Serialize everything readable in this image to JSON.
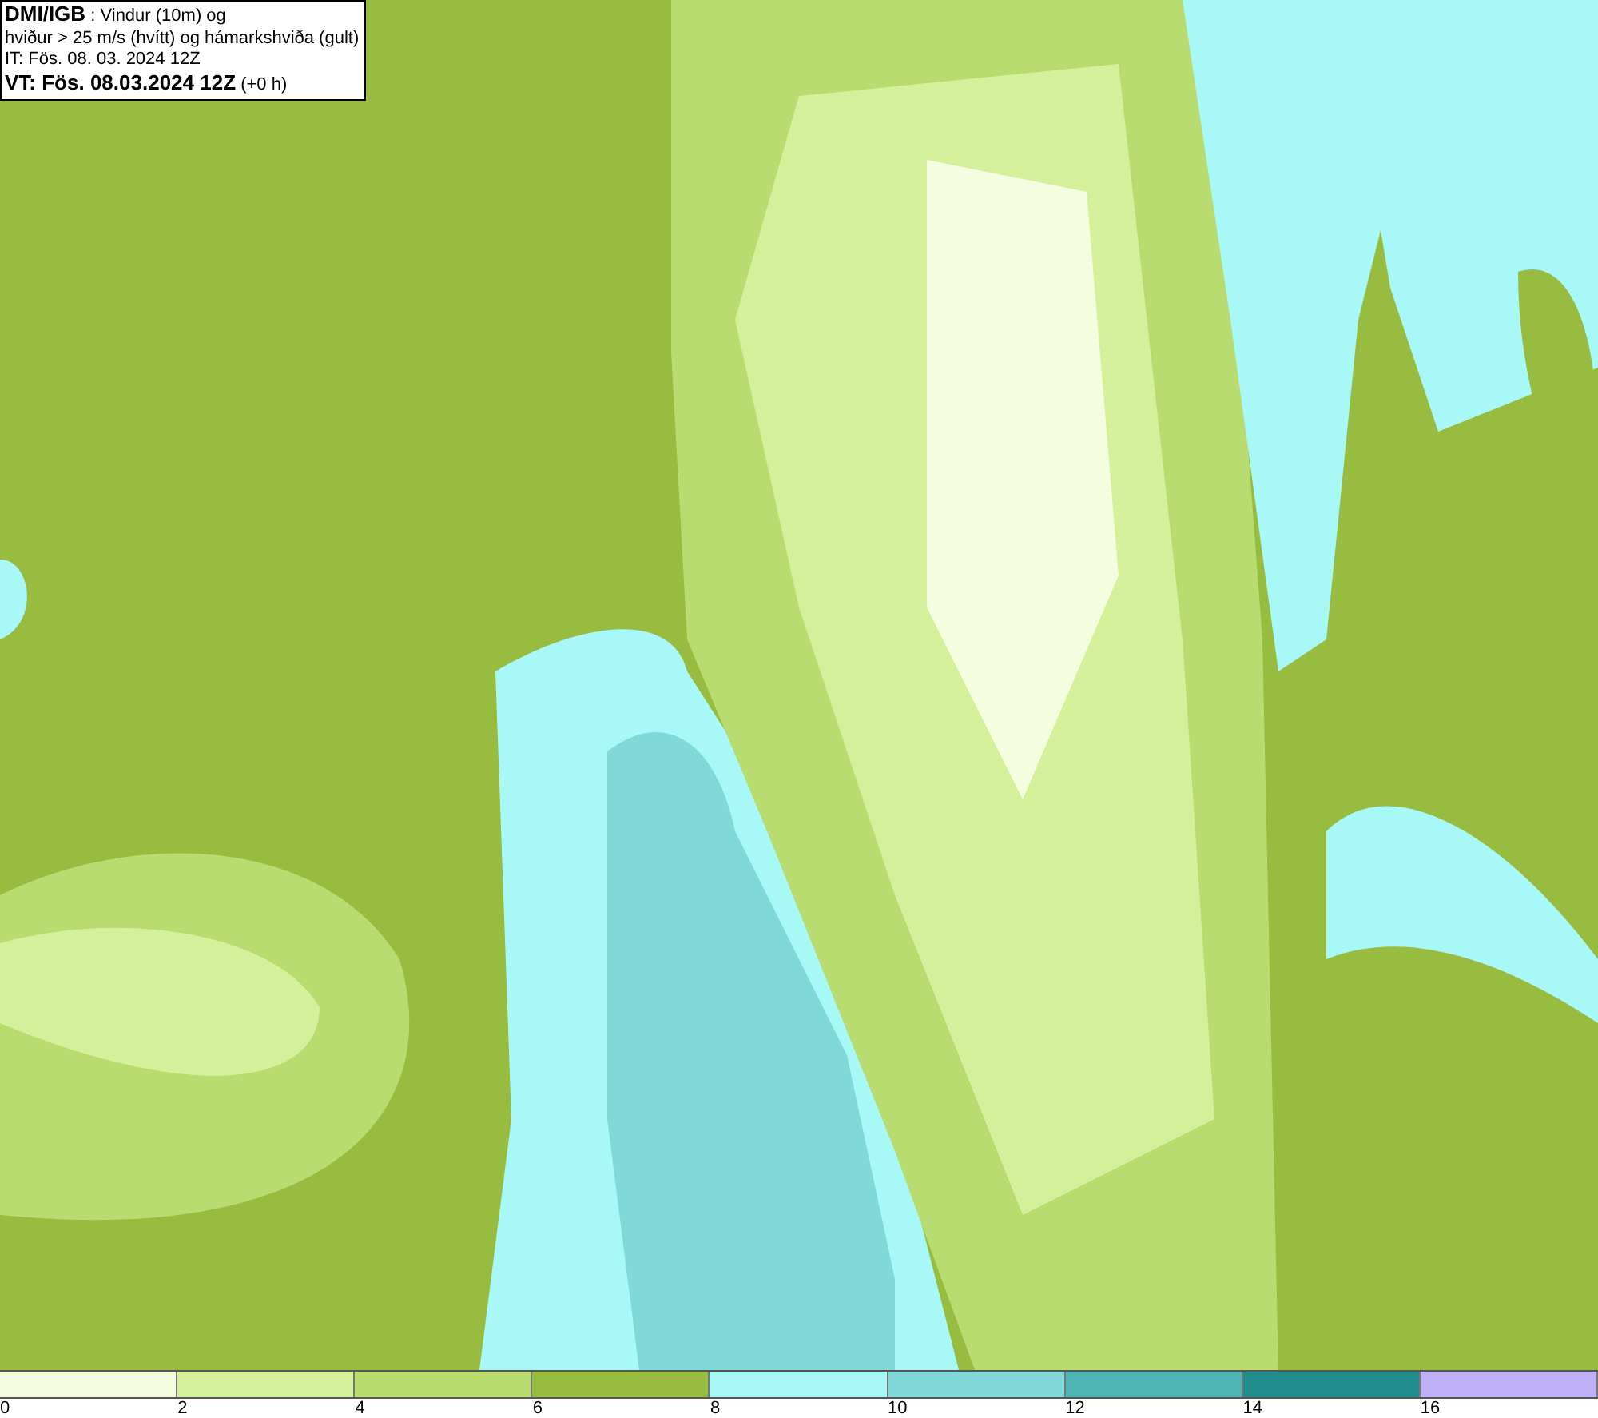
{
  "info_box": {
    "lines": [
      "**DMI/IGB** : Vindur (10m) og",
      "hviður > 25 m/s (hvítt) og hámarkshviða (gult)",
      "IT: Fös. 08. 03. 2024 12Z",
      "**VT: Fös. 08.03.2024 12Z** (+0 h)"
    ]
  },
  "legend": [
    {
      "color": "#f5fde0",
      "label": "0"
    },
    {
      "color": "#d4f09a",
      "label": "2"
    },
    {
      "color": "#b8dc70",
      "label": "4"
    },
    {
      "color": "#98bc40",
      "label": "6"
    },
    {
      "color": "#a8f8f8",
      "label": "8"
    },
    {
      "color": "#80d8d8",
      "label": "10"
    },
    {
      "color": "#50b4b4",
      "label": "12"
    },
    {
      "color": "#208c8c",
      "label": "14"
    },
    {
      "color": "#c0b0f8",
      "label": "16"
    }
  ]
}
